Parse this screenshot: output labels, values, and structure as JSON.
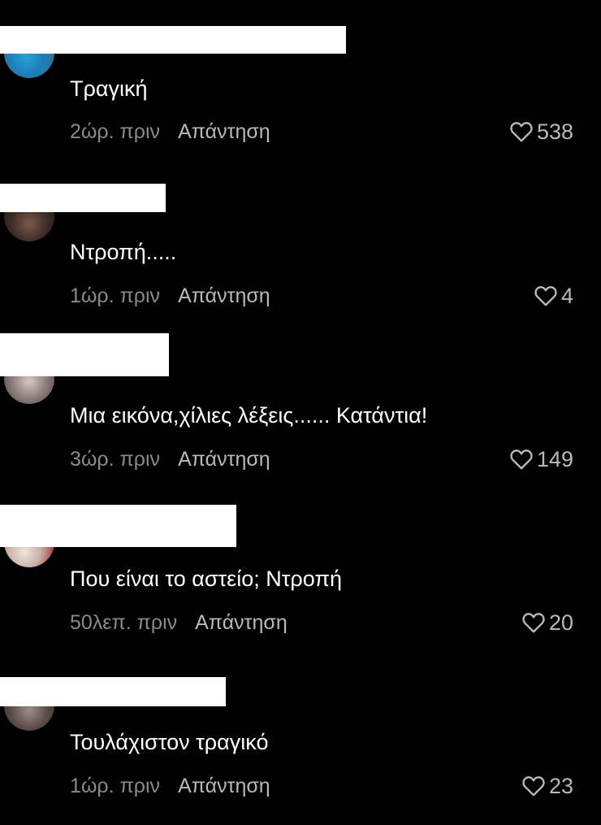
{
  "colors": {
    "background": "#000000",
    "text": "#ffffff",
    "time": "#8a8a8a",
    "action": "#b9b9b9",
    "redaction": "#ffffff"
  },
  "icons": {
    "like": "heart-outline-icon"
  },
  "comments": [
    {
      "text": "Τραγική",
      "time": "2ώρ. πριν",
      "reply_label": "Απάντηση",
      "likes": "538"
    },
    {
      "text": "Ντροπή.....",
      "time": "1ώρ. πριν",
      "reply_label": "Απάντηση",
      "likes": "4"
    },
    {
      "text": "Μια εικόνα,χίλιες λέξεις...... Κατάντια!",
      "time": "3ώρ. πριν",
      "reply_label": "Απάντηση",
      "likes": "149"
    },
    {
      "text": "Που είναι το αστείο; Ντροπή",
      "time": "50λεπ. πριν",
      "reply_label": "Απάντηση",
      "likes": "20"
    },
    {
      "text": "Τουλάχιστον τραγικό",
      "time": "1ώρ. πριν",
      "reply_label": "Απάντηση",
      "likes": "23"
    }
  ]
}
